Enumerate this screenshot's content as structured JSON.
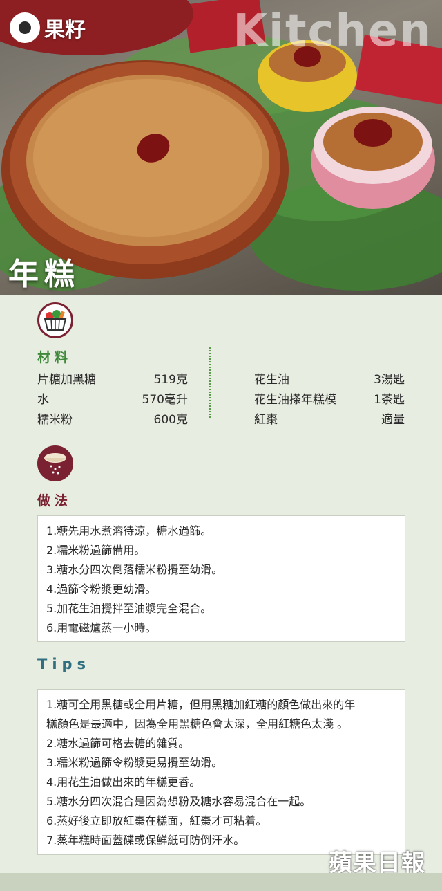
{
  "brand": {
    "name": "果籽",
    "logo_icon": "brand-logo-icon"
  },
  "hero": {
    "watermark": "Kitchen",
    "title": "年糕"
  },
  "ingredients": {
    "heading": "材料",
    "icon": "vegetable-basket-icon",
    "left": [
      {
        "name": "片糖加黑糖",
        "qty": "519克"
      },
      {
        "name": "水",
        "qty": "570毫升"
      },
      {
        "name": "糯米粉",
        "qty": "600克"
      }
    ],
    "right": [
      {
        "name": "花生油",
        "qty": "3湯匙"
      },
      {
        "name": "花生油搽年糕模",
        "qty": "1茶匙"
      },
      {
        "name": "紅棗",
        "qty": "適量"
      }
    ]
  },
  "method": {
    "heading": "做法",
    "icon": "flour-sieve-icon",
    "steps": [
      "1.糖先用水煮溶待涼，糖水過篩。",
      "2.糯米粉過篩備用。",
      "3.糖水分四次倒落糯米粉攪至幼滑。",
      "4.過篩令粉漿更幼滑。",
      "5.加花生油攪拌至油漿完全混合。",
      "6.用電磁爐蒸一小時。"
    ]
  },
  "tips": {
    "heading": "Tips",
    "lines": [
      "1.糖可全用黑糖或全用片糖，但用黑糖加紅糖的顏色做出來的年",
      "糕顏色是最適中，因為全用黑糖色會太深，全用紅糖色太淺 。",
      "2.糖水過篩可格去糖的雜質。",
      "3.糯米粉過篩令粉漿更易攪至幼滑。",
      "4.用花生油做出來的年糕更香。",
      "5.糖水分四次混合是因為想粉及糖水容易混合在一起。",
      "6.蒸好後立即放紅棗在糕面，紅棗才可粘着。",
      "7.蒸年糕時面蓋碟或保鮮紙可防倒汗水。"
    ]
  },
  "footer": {
    "publisher": "蘋果日報"
  },
  "colors": {
    "heading_green": "#3f8a3a",
    "tips_blue": "#2f6f7f",
    "background": "#e8ede2"
  }
}
